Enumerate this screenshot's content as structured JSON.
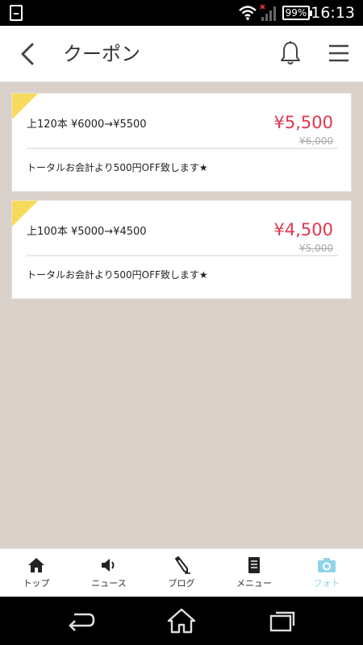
{
  "status_bar": {
    "battery": "99%",
    "time": "16:13"
  },
  "header": {
    "title": "クーポン",
    "back_icon": "chevron-left-icon",
    "bell_icon": "bell-icon",
    "menu_icon": "hamburger-menu-icon"
  },
  "coupons": [
    {
      "name": "上120本 ¥6000→¥5500",
      "price": "¥5,500",
      "original_price": "¥6,000",
      "description": "トータルお会計より500円OFF致します★"
    },
    {
      "name": "上100本 ¥5000→¥4500",
      "price": "¥4,500",
      "original_price": "¥5,000",
      "description": "トータルお会計より500円OFF致します★"
    }
  ],
  "tabs": [
    {
      "label": "トップ",
      "icon": "home-icon"
    },
    {
      "label": "ニュース",
      "icon": "megaphone-icon"
    },
    {
      "label": "ブログ",
      "icon": "pencil-icon"
    },
    {
      "label": "メニュー",
      "icon": "document-icon"
    },
    {
      "label": "フォト",
      "icon": "camera-icon",
      "active": true
    }
  ],
  "colors": {
    "accent_price": "#e0364d",
    "active_tab": "#8fd3e8",
    "background": "#d9d0ca",
    "corner_badge": "#f7da5c"
  }
}
